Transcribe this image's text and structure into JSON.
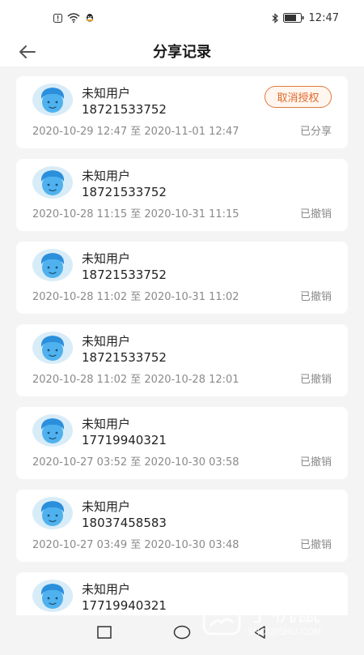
{
  "status_bar": {
    "time": "12:47",
    "left_icons": [
      "alert-icon",
      "wifi-icon",
      "qq-icon"
    ],
    "right_icons": [
      "bluetooth-icon",
      "battery-icon"
    ]
  },
  "header": {
    "title": "分享记录",
    "back_icon": "arrow-left-icon"
  },
  "records": [
    {
      "name": "未知用户",
      "phone": "18721533752",
      "time_range": "2020-10-29 12:47 至 2020-11-01 12:47",
      "status": "已分享",
      "action": "取消授权"
    },
    {
      "name": "未知用户",
      "phone": "18721533752",
      "time_range": "2020-10-28 11:15 至 2020-10-31 11:15",
      "status": "已撤销"
    },
    {
      "name": "未知用户",
      "phone": "18721533752",
      "time_range": "2020-10-28 11:02 至 2020-10-31 11:02",
      "status": "已撤销"
    },
    {
      "name": "未知用户",
      "phone": "18721533752",
      "time_range": "2020-10-28 11:02 至 2020-10-28 12:01",
      "status": "已撤销"
    },
    {
      "name": "未知用户",
      "phone": "17719940321",
      "time_range": "2020-10-27 03:52 至 2020-10-30 03:58",
      "status": "已撤销"
    },
    {
      "name": "未知用户",
      "phone": "18037458583",
      "time_range": "2020-10-27 03:49 至 2020-10-30 03:48",
      "status": "已撤销"
    },
    {
      "name": "未知用户",
      "phone": "17719940321"
    }
  ],
  "nav_bar": {
    "buttons": [
      "recent-apps-icon",
      "home-icon",
      "back-triangle-icon"
    ]
  },
  "watermark": {
    "text": "手机鼠",
    "subtext": "SHOUJISHU.COM"
  },
  "colors": {
    "accent": "#e0692a",
    "avatar": "#3aa0e8",
    "background": "#f4f4f4"
  }
}
